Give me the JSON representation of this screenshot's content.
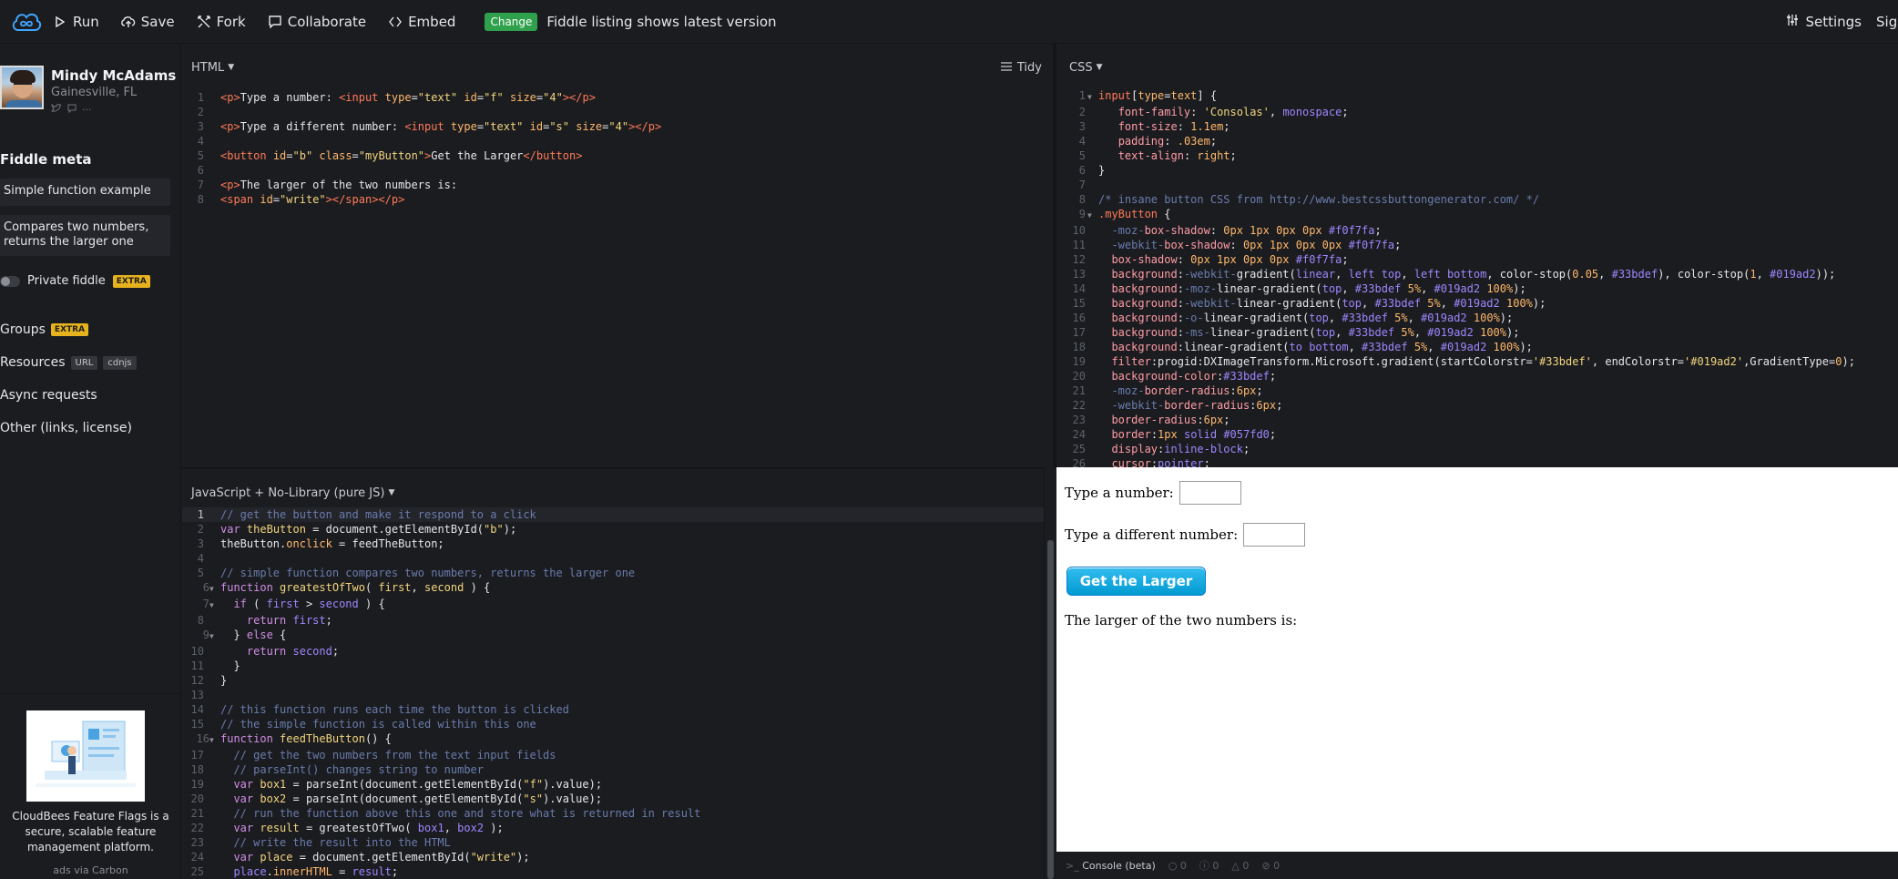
{
  "topbar": {
    "run": "Run",
    "save": "Save",
    "fork": "Fork",
    "collaborate": "Collaborate",
    "embed": "Embed",
    "change_badge": "Change",
    "change_message": "Fiddle listing shows latest version",
    "settings": "Settings",
    "sign_in": "Sign in"
  },
  "sidebar": {
    "user_name": "Mindy McAdams",
    "user_location": "Gainesville, FL",
    "fiddle_meta_title": "Fiddle meta",
    "meta_title_value": "Simple function example",
    "meta_description_value": "Compares two numbers, returns the larger one",
    "private_label": "Private fiddle",
    "extra_badge": "EXTRA",
    "groups": "Groups",
    "resources": "Resources",
    "url_chip": "URL",
    "cdnjs_chip": "cdnjs",
    "async_requests": "Async requests",
    "other": "Other (links, license)",
    "ad_text": "CloudBees Feature Flags is a secure, scalable feature management platform.",
    "ad_via": "ads via Carbon"
  },
  "panels": {
    "html_title": "HTML",
    "tidy": "Tidy",
    "css_title": "CSS",
    "js_title": "JavaScript + No-Library (pure JS)"
  },
  "html_code": [
    "1",
    "2",
    "3",
    "4",
    "5",
    "6",
    "7",
    "8"
  ],
  "result": {
    "label_first": "Type a number:",
    "label_second": "Type a different number:",
    "button": "Get the Larger",
    "larger_text": "The larger of the two numbers is:"
  },
  "console": {
    "label": "Console (beta)",
    "c0": "0",
    "c1": "0",
    "c2": "0",
    "c3": "0"
  },
  "colors": {
    "background": "#1b1c1f",
    "change_badge": "#2fa14d",
    "extra_badge": "#e6b31e",
    "button_top": "#33bdef",
    "button_bottom": "#019ad2"
  }
}
